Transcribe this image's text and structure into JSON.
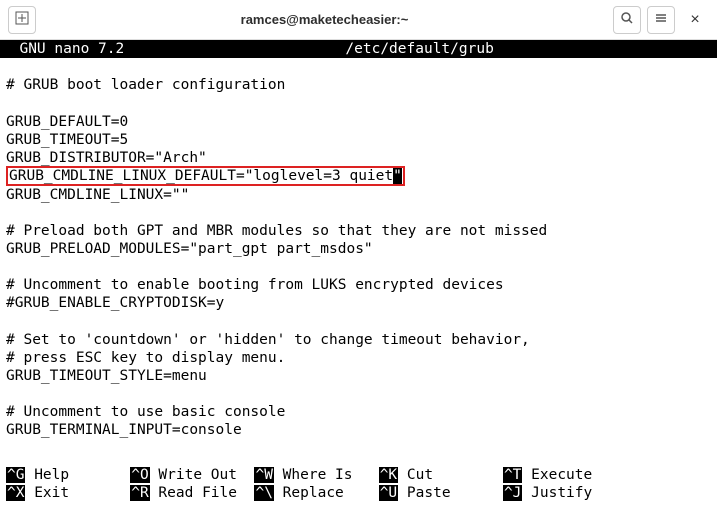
{
  "titlebar": {
    "new_tab_icon": "⊞",
    "title": "ramces@maketecheasier:~",
    "search_icon": "Q",
    "menu_icon": "≡",
    "close_icon": "×"
  },
  "nano": {
    "app_name": "  GNU nano 7.2",
    "file_path": "/etc/default/grub"
  },
  "content": {
    "l01": "# GRUB boot loader configuration",
    "l02": "",
    "l03": "GRUB_DEFAULT=0",
    "l04": "GRUB_TIMEOUT=5",
    "l05": "GRUB_DISTRIBUTOR=\"Arch\"",
    "l06_pre": "GRUB_CMDLINE_LINUX_DEFAULT=\"loglevel=3 quiet",
    "l06_cursor": "\"",
    "l07": "GRUB_CMDLINE_LINUX=\"\"",
    "l08": "",
    "l09": "# Preload both GPT and MBR modules so that they are not missed",
    "l10": "GRUB_PRELOAD_MODULES=\"part_gpt part_msdos\"",
    "l11": "",
    "l12": "# Uncomment to enable booting from LUKS encrypted devices",
    "l13": "#GRUB_ENABLE_CRYPTODISK=y",
    "l14": "",
    "l15": "# Set to 'countdown' or 'hidden' to change timeout behavior,",
    "l16": "# press ESC key to display menu.",
    "l17": "GRUB_TIMEOUT_STYLE=menu",
    "l18": "",
    "l19": "# Uncomment to use basic console",
    "l20": "GRUB_TERMINAL_INPUT=console"
  },
  "shortcuts": {
    "row1": {
      "k1": "^G",
      "l1": " Help       ",
      "k2": "^O",
      "l2": " Write Out  ",
      "k3": "^W",
      "l3": " Where Is   ",
      "k4": "^K",
      "l4": " Cut        ",
      "k5": "^T",
      "l5": " Execute"
    },
    "row2": {
      "k1": "^X",
      "l1": " Exit       ",
      "k2": "^R",
      "l2": " Read File  ",
      "k3": "^\\",
      "l3": " Replace    ",
      "k4": "^U",
      "l4": " Paste      ",
      "k5": "^J",
      "l5": " Justify"
    }
  }
}
